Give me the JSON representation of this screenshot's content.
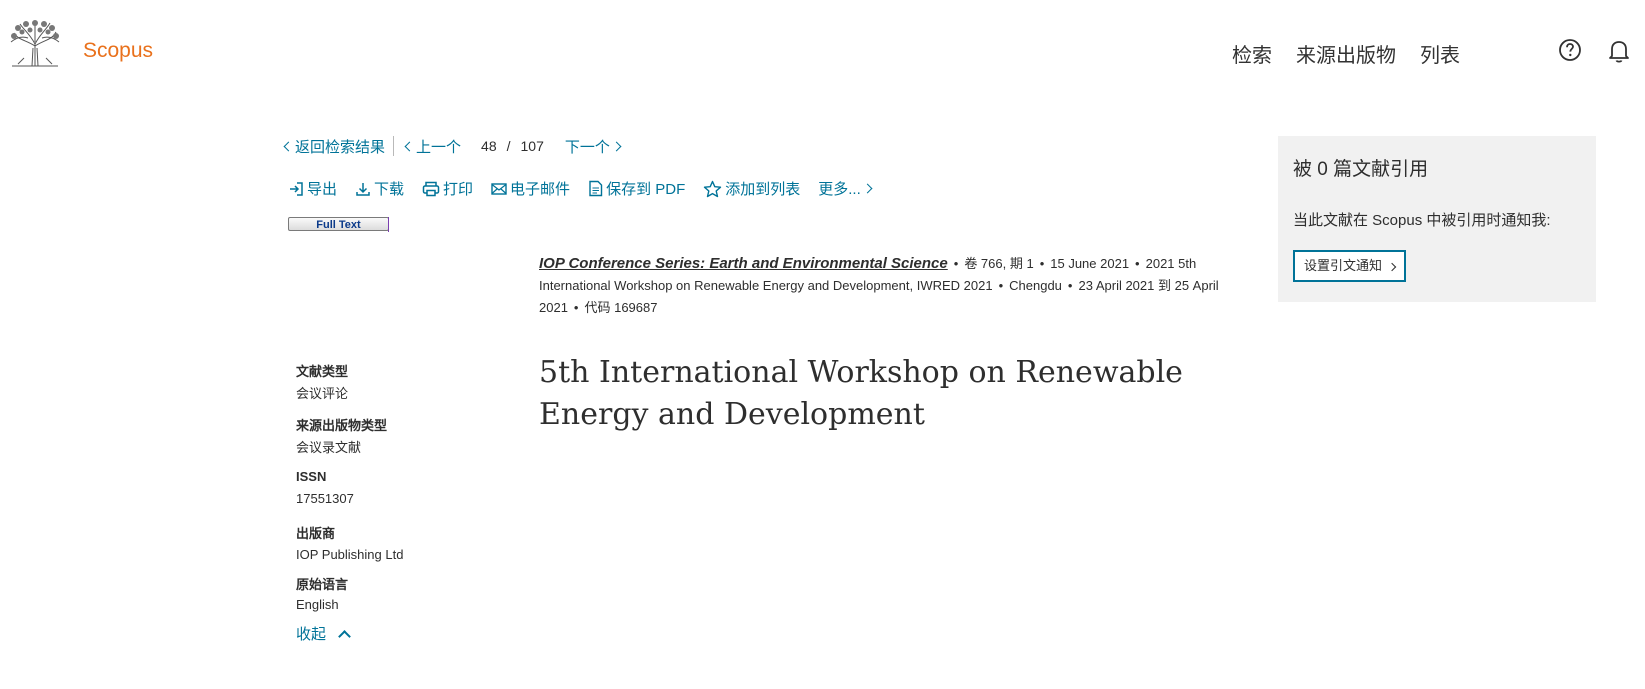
{
  "header": {
    "brand": "Scopus",
    "nav": [
      "检索",
      "来源出版物",
      "列表"
    ],
    "icons": [
      "help-icon",
      "bell-icon"
    ]
  },
  "nav_row": {
    "back": "返回检索结果",
    "prev": "上一个",
    "current": "48",
    "divider": "/",
    "total": "107",
    "next": "下一个"
  },
  "toolbar": {
    "export": "导出",
    "download": "下载",
    "print": "打印",
    "email": "电子邮件",
    "save_pdf": "保存到 PDF",
    "add_list": "添加到列表",
    "more": "更多..."
  },
  "full_text_button": "Full Text",
  "source": {
    "journal": "IOP Conference Series: Earth and Environmental Science",
    "volume": "卷 766, 期 1",
    "date": "15 June 2021",
    "conference": "2021 5th International Workshop on Renewable Energy and Development, IWRED 2021",
    "location": "Chengdu",
    "conf_dates": "23 April 2021 到 25 April 2021",
    "code": "代码 169687"
  },
  "document_title": "5th International Workshop on Renewable Energy and Development",
  "metadata": [
    {
      "label": "文献类型",
      "value": "会议评论"
    },
    {
      "label": "来源出版物类型",
      "value": "会议录文献"
    },
    {
      "label": "ISSN",
      "value": "17551307"
    },
    {
      "label": "出版商",
      "value": "IOP Publishing Ltd"
    },
    {
      "label": "原始语言",
      "value": "English"
    }
  ],
  "collapse_label": "收起",
  "citations": {
    "count_text": "被 0 篇文献引用",
    "notify_text": "当此文献在 Scopus 中被引用时通知我:",
    "alert_button": "设置引文通知"
  },
  "colors": {
    "accent": "#007398",
    "brand": "#e9711c",
    "panel_bg": "#f1f1f1"
  }
}
